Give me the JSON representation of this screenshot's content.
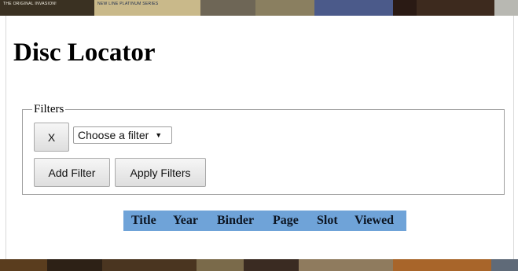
{
  "banner_top": {
    "tiles": [
      {
        "text": "THE ORIGINAL INVASION!",
        "color": "#3a3122"
      },
      {
        "text": "NEW LINE PLATINUM SERIES",
        "color": "#c9b98a",
        "dark": true
      },
      {
        "text": "",
        "color": "#6e6656"
      },
      {
        "text": "",
        "color": "#8a7f60"
      },
      {
        "text": "",
        "color": "#4b5a8a"
      },
      {
        "text": "",
        "color": "#2a1a14"
      },
      {
        "text": "",
        "color": "#3d2a1e"
      },
      {
        "text": "",
        "color": "#b8b8b2"
      }
    ]
  },
  "banner_bottom": {
    "tiles": [
      {
        "color": "#5a3d1e"
      },
      {
        "color": "#2d2116"
      },
      {
        "color": "#4a3520"
      },
      {
        "color": "#7a6a4a"
      },
      {
        "color": "#3a2b22"
      },
      {
        "color": "#8f7b5e"
      },
      {
        "color": "#a8652a"
      },
      {
        "color": "#5f6a78"
      }
    ]
  },
  "page": {
    "title": "Disc Locator"
  },
  "filters": {
    "legend": "Filters",
    "remove_label": "X",
    "select_value": "Choose a filter",
    "add_label": "Add Filter",
    "apply_label": "Apply Filters"
  },
  "table": {
    "header_color": "#6fa3d8",
    "columns": [
      "Title",
      "Year",
      "Binder",
      "Page",
      "Slot",
      "Viewed"
    ]
  }
}
